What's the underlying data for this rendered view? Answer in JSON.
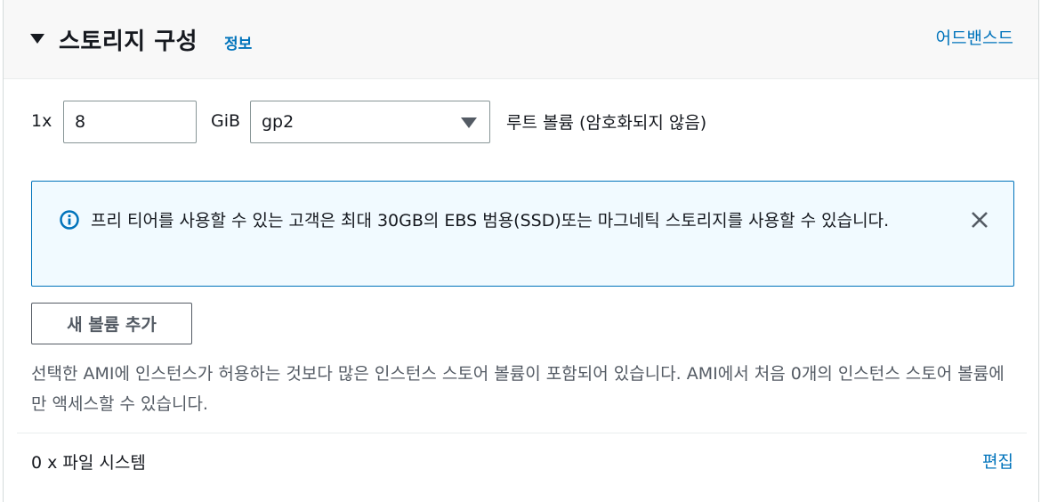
{
  "header": {
    "title": "스토리지 구성",
    "info_link": "정보",
    "advanced_link": "어드밴스드"
  },
  "volume": {
    "multiplier": "1x",
    "size_value": "8",
    "unit": "GiB",
    "type_selected": "gp2",
    "root_label": "루트 볼륨  (암호화되지 않음)"
  },
  "alert": {
    "text": "프리 티어를 사용할 수 있는 고객은 최대 30GB의 EBS 범용(SSD)또는 마그네틱 스토리지를 사용할 수 있습니다."
  },
  "add_volume_button": "새 볼륨 추가",
  "description": "선택한 AMI에 인스턴스가 허용하는 것보다 많은 인스턴스 스토어 볼륨이 포함되어 있습니다. AMI에서 처음 0개의 인스턴스 스토어 볼륨에만 액세스할 수 있습니다.",
  "file_system": {
    "label": "0 x 파일 시스템",
    "edit_link": "편집"
  },
  "colors": {
    "link": "#0073bb",
    "alert_bg": "#f1faff",
    "alert_border": "#0073bb",
    "text": "#16191f",
    "secondary_text": "#545b64"
  },
  "icons": {
    "collapse": "caret-down-icon",
    "alert": "info-circle-icon",
    "close": "close-icon",
    "select": "dropdown-caret-icon"
  }
}
